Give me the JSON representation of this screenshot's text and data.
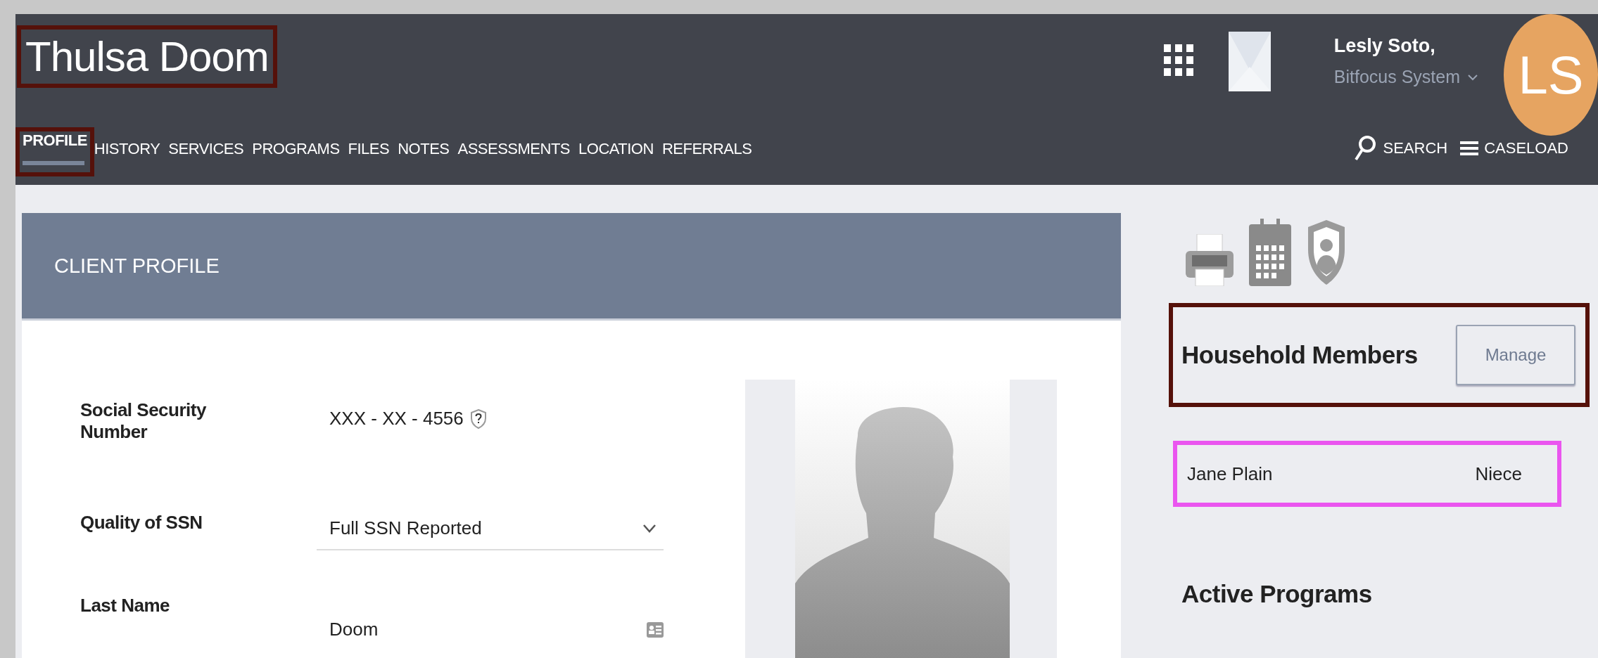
{
  "header": {
    "client_name": {
      "text": "Thulsa Doom",
      "color": "#55110a"
    },
    "tabs": [
      {
        "label": "PROFILE",
        "selected": true,
        "color": "#55110a"
      },
      {
        "label": "HISTORY",
        "selected": false
      },
      {
        "label": "SERVICES",
        "selected": false
      },
      {
        "label": "PROGRAMS",
        "selected": false
      },
      {
        "label": "FILES",
        "selected": false
      },
      {
        "label": "NOTES",
        "selected": false
      },
      {
        "label": "ASSESSMENTS",
        "selected": false
      },
      {
        "label": "LOCATION",
        "selected": false
      },
      {
        "label": "REFERRALS",
        "selected": false
      }
    ],
    "user": {
      "name": "Lesly Soto,",
      "organization": "Bitfocus System",
      "initials": "LS"
    },
    "actions": [
      "SEARCH",
      "CASELOAD"
    ]
  },
  "client_profile": {
    "title": "CLIENT PROFILE",
    "fields": [
      {
        "kind": "masked",
        "label": "Social Security Number",
        "value": "XXX - XX - 4556"
      },
      {
        "kind": "select",
        "label": "Quality of SSN",
        "value": "Full SSN Reported"
      },
      {
        "kind": "text",
        "label": "Last Name",
        "value": "Doom"
      }
    ]
  },
  "household": {
    "title": "Household Members",
    "button": "Manage",
    "color": "#55110a",
    "members": [
      {
        "name": "Jane Plain",
        "relation": "Niece",
        "color": "#ea55ef"
      }
    ]
  },
  "active_programs": {
    "title": "Active Programs"
  }
}
